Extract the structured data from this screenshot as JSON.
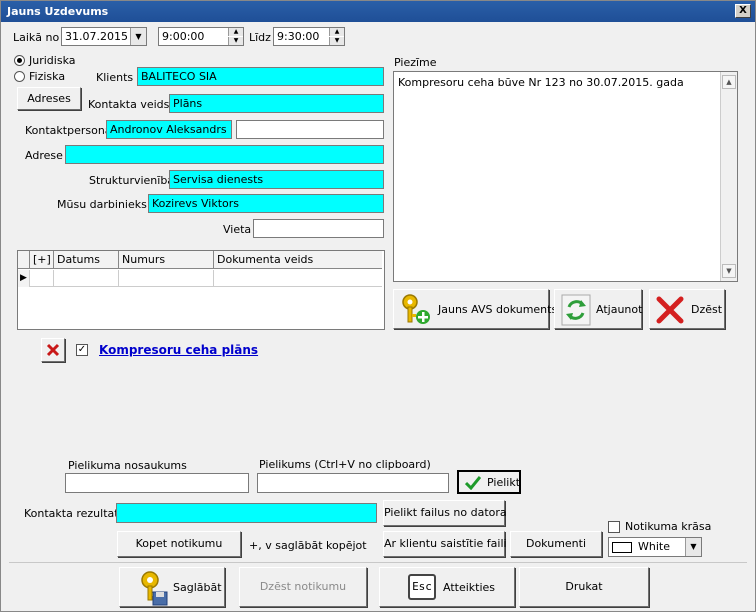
{
  "window": {
    "title": "Jauns Uzdevums",
    "close_label": "X"
  },
  "time_row": {
    "from_label": "Laikā no",
    "date_value": "31.07.2015",
    "time_from": "9:00:00",
    "to_label": "Līdz",
    "time_to": "9:30:00"
  },
  "client_type": {
    "option_legal": "Juridiska",
    "option_person": "Fiziska",
    "selected": "Juridiska"
  },
  "form": {
    "addresses_button": "Adreses",
    "client_label": "Klients *",
    "client_value": "BALITECO SIA",
    "contact_type_label": "Kontakta veids *",
    "contact_type_value": "Plāns",
    "contact_person_label": "Kontaktpersona",
    "contact_person_value": "Andronov Aleksandrs",
    "contact_person_extra": "",
    "address_label": "Adrese",
    "address_value": "",
    "unit_label": "Strukturvienība",
    "unit_value": "Servisa dienests",
    "employee_label": "Mūsu darbinieks *",
    "employee_value": "Kozirevs Viktors",
    "place_label": "Vieta",
    "place_value": ""
  },
  "documents_grid": {
    "columns": [
      "[+]",
      "Datums",
      "Numurs",
      "Dokumenta veids"
    ],
    "rows": [
      [
        "",
        "",
        "",
        ""
      ]
    ]
  },
  "note": {
    "label": "Piezīme",
    "text": "Kompresoru ceha būve Nr 123 no 30.07.2015. gada"
  },
  "note_actions": {
    "new_doc_button": "Jauns AVS dokuments",
    "refresh_button": "Atjaunot",
    "delete_button": "Dzēst"
  },
  "attachment": {
    "link_text": "Kompresoru ceha plāns",
    "checked": true,
    "name_label": "Pielikuma nosaukums",
    "name_value": "",
    "clipboard_label": "Pielikums (Ctrl+V no clipboard)",
    "clipboard_value": "",
    "attach_button": "Pielikt"
  },
  "result": {
    "label": "Kontakta rezultats",
    "value": "",
    "attach_files_button": "Pielikt failus no datora",
    "copy_button": "Kopet notikumu",
    "copy_hint": "+, v saglābāt kopējot",
    "client_files_button": "Ar klientu saistītie faili",
    "documents_button": "Dokumenti",
    "color_label": "Notikuma krāsa",
    "color_value": "White"
  },
  "bottom": {
    "save_button": "Saglābāt",
    "delete_event_button": "Dzēst notikumu",
    "cancel_button": "Atteikties",
    "cancel_icon_text": "Esc",
    "print_button": "Drukat"
  }
}
